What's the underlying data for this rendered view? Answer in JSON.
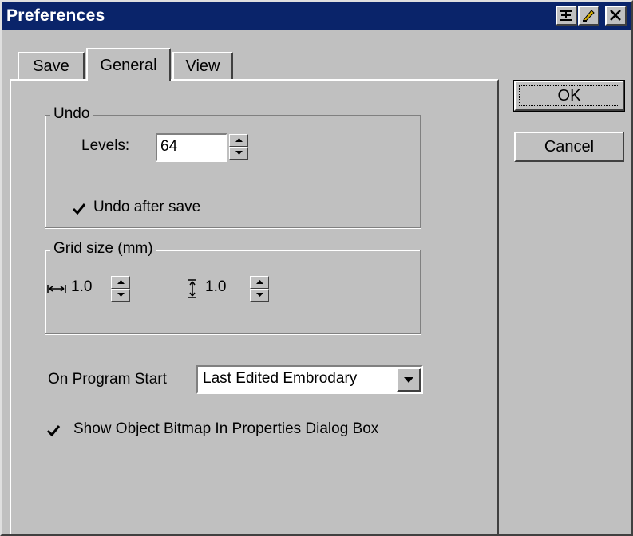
{
  "window": {
    "title": "Preferences"
  },
  "titlebar_buttons": [
    {
      "name": "pin-icon"
    },
    {
      "name": "settings-icon"
    },
    {
      "name": "close-icon"
    }
  ],
  "tabs": [
    {
      "label": "Save",
      "active": false
    },
    {
      "label": "General",
      "active": true
    },
    {
      "label": "View",
      "active": false
    }
  ],
  "undo": {
    "group_label": "Undo",
    "levels_label": "Levels:",
    "levels_value": "64",
    "undo_after_save_label": "Undo after save",
    "undo_after_save_checked": true
  },
  "grid": {
    "group_label": "Grid size (mm)",
    "horizontal_value": "1.0",
    "vertical_value": "1.0"
  },
  "program_start": {
    "label": "On Program Start",
    "selected": "Last Edited Embrodary"
  },
  "show_bitmap": {
    "label": "Show Object Bitmap In Properties Dialog Box",
    "checked": true
  },
  "buttons": {
    "ok": "OK",
    "cancel": "Cancel"
  },
  "colors": {
    "titlebar": "#0a246a",
    "face": "#c0c0c0"
  }
}
